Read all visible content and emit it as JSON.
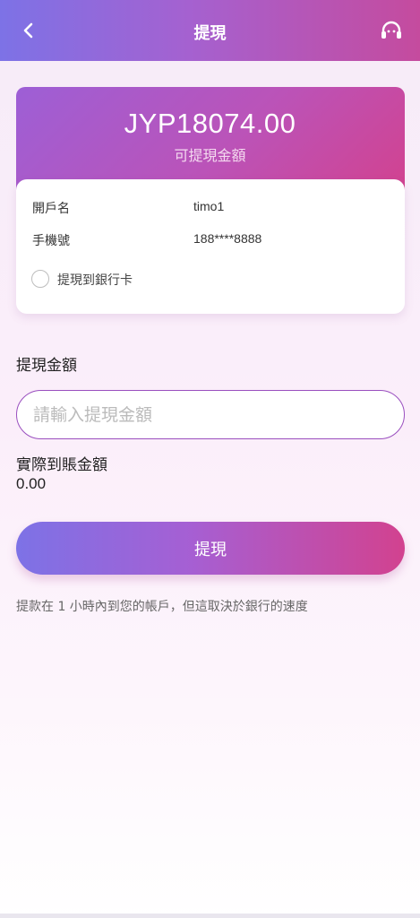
{
  "header": {
    "title": "提現",
    "back_icon": "chevron-left-icon",
    "support_icon": "headset-icon"
  },
  "balance": {
    "amount": "JYP18074.00",
    "label": "可提現金額"
  },
  "account": {
    "name_label": "開戶名",
    "name_value": "timo1",
    "phone_label": "手機號",
    "phone_value": "188****8888",
    "bank_option_label": "提現到銀行卡"
  },
  "withdraw": {
    "amount_label": "提現金額",
    "amount_placeholder": "請輸入提現金額",
    "amount_value": "",
    "actual_label": "實際到賬金額",
    "actual_value": "0.00",
    "submit_label": "提現",
    "note": "提款在 1 小時內到您的帳戶，但這取決於銀行的速度"
  },
  "colors": {
    "accent_start": "#7d72e6",
    "accent_end": "#d2428f",
    "input_border": "#9a4fbf"
  }
}
